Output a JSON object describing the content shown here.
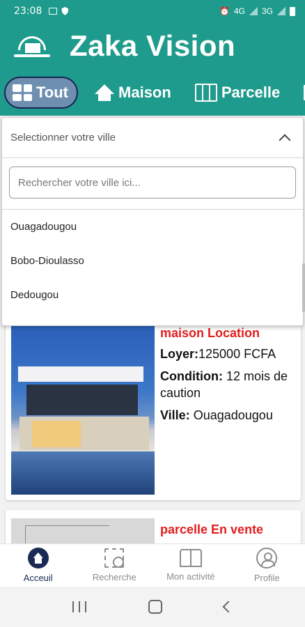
{
  "status_bar": {
    "time": "23:08",
    "network_4g": "4G",
    "network_3g": "3G"
  },
  "app": {
    "title": "Zaka Vision"
  },
  "tabs": [
    {
      "label": "Tout",
      "icon": "grid-icon",
      "active": true
    },
    {
      "label": "Maison",
      "icon": "home-icon",
      "active": false
    },
    {
      "label": "Parcelle",
      "icon": "map-icon",
      "active": false
    }
  ],
  "dropdown": {
    "placeholder": "Selectionner votre ville",
    "search_placeholder": "Rechercher votre ville ici...",
    "options": [
      "Ouagadougou",
      "Bobo-Dioulasso",
      "Dedougou"
    ]
  },
  "listings": [
    {
      "title": "maison Location",
      "rent_label": "Loyer:",
      "rent_value": "125000 FCFA",
      "condition_label": "Condition:",
      "condition_value": "12 mois de caution",
      "city_label": "Ville:",
      "city_value": "Ouagadougou"
    },
    {
      "title": "parcelle En vente"
    }
  ],
  "bottom_nav": [
    {
      "label": "Acceuil",
      "icon": "home-circle-icon",
      "active": true
    },
    {
      "label": "Recherche",
      "icon": "image-search-icon",
      "active": false
    },
    {
      "label": "Mon activité",
      "icon": "open-book-icon",
      "active": false
    },
    {
      "label": "Profile",
      "icon": "account-circle-icon",
      "active": false
    }
  ],
  "colors": {
    "primary": "#1e9b8c",
    "active_tab": "#6f8fb1",
    "accent_red": "#e21d1d",
    "nav_active": "#1a2a55"
  }
}
